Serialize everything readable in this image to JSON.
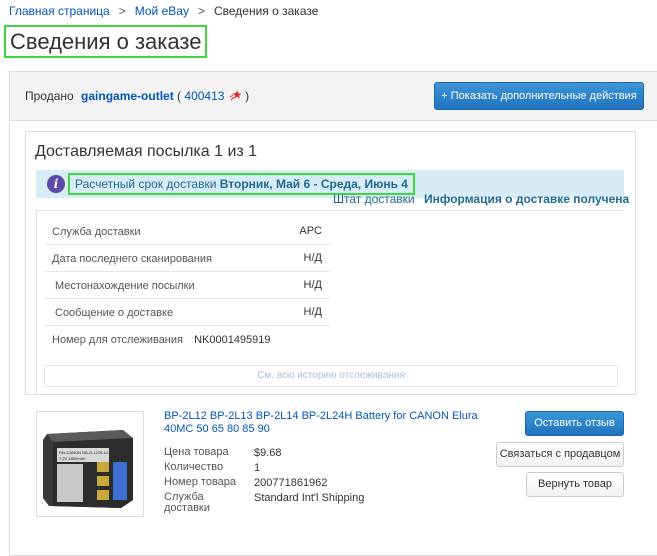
{
  "breadcrumb": {
    "home": "Главная страница",
    "sep1": ">",
    "my_ebay": "Мой eBay",
    "sep2": ">",
    "current": "Сведения о заказе"
  },
  "page_title": "Сведения о заказе",
  "seller": {
    "sold_label": "Продано",
    "name": "gaingame-outlet",
    "paren_open": "(",
    "score": "400413",
    "paren_close": ")",
    "star_icon": "shooting-star-icon"
  },
  "show_actions_label": "+ Показать дополнительные действия",
  "package": {
    "title": "Доставляемая посылка 1 из 1",
    "estimate_label": "Расчетный срок доставки",
    "estimate_dates": "Вторник, Май 6 - Среда, Июнь 4",
    "status_label": "Штат доставки",
    "status_value": "Информация о доставке получена",
    "rows": [
      {
        "label": "Служба доставки",
        "value": "APC"
      },
      {
        "label": "Дата последнего сканирования",
        "value": "Н/Д"
      },
      {
        "label": "Местонахождение посылки",
        "value": "Н/Д"
      },
      {
        "label": "Сообщение о доставке",
        "value": "Н/Д"
      }
    ],
    "tracking_label": "Номер для отслеживания",
    "tracking_number": "NK0001495919",
    "history_label": "См. всю историю отслеживания"
  },
  "item": {
    "title": "BP-2L12 BP-2L13 BP-2L14 BP-2L24H Battery for CANON Elura 40MC 50 65 80 85 90",
    "battery_label_line1": "Fits CANON NB-2L12/2L14",
    "battery_label_line2": "7.2V 1800mAh",
    "details": [
      {
        "label": "Цена товара",
        "value": "$9.68"
      },
      {
        "label": "Количество",
        "value": "1"
      },
      {
        "label": "Номер товара",
        "value": "200771861962"
      },
      {
        "label": "Служба доставки",
        "value": "Standard Int'l Shipping"
      }
    ]
  },
  "actions": {
    "feedback": "Оставить отзыв",
    "contact": "Связаться с продавцом",
    "return": "Вернуть товар"
  },
  "colors": {
    "link": "#0654ba",
    "primary_button": "#1f73bd",
    "highlight_outline": "#3fd83f",
    "info_bar": "#d8ecf6",
    "info_icon": "#5c4aa6"
  }
}
